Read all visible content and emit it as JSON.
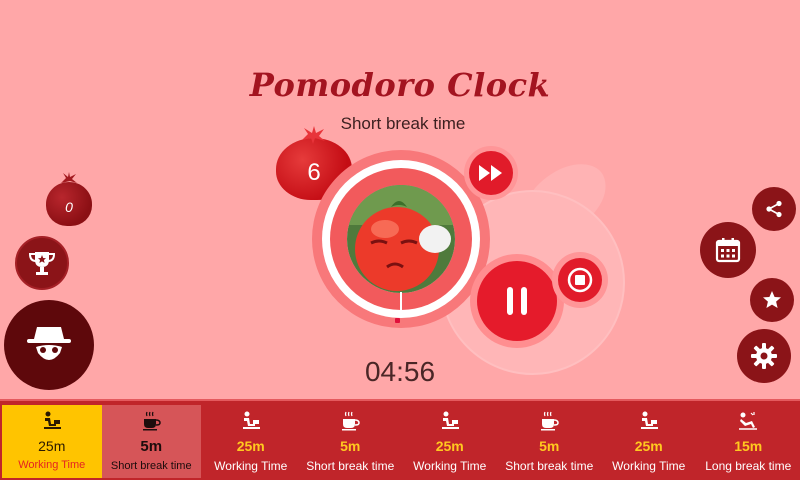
{
  "header": {
    "title": "Pomodoro Clock",
    "subtitle": "Short break time"
  },
  "timer": {
    "completed_tomatoes": "6",
    "remaining_time": "04:56"
  },
  "left_panel": {
    "daily_count": "0"
  },
  "controls": {
    "skip_icon": "fast-forward-icon",
    "pause_icon": "pause-icon",
    "stop_icon": "stop-icon"
  },
  "right_panel": {
    "icons": [
      "share-icon",
      "calendar-icon",
      "star-icon",
      "gear-icon"
    ]
  },
  "schedule": [
    {
      "icon": "worker-desk-icon",
      "duration": "25m",
      "label": "Working Time",
      "state": "active-work"
    },
    {
      "icon": "coffee-cup-icon",
      "duration": "5m",
      "label": "Short break time",
      "state": "active-break"
    },
    {
      "icon": "worker-desk-icon",
      "duration": "25m",
      "label": "Working Time",
      "state": "work"
    },
    {
      "icon": "coffee-cup-icon",
      "duration": "5m",
      "label": "Short break time",
      "state": "break"
    },
    {
      "icon": "worker-desk-icon",
      "duration": "25m",
      "label": "Working Time",
      "state": "work"
    },
    {
      "icon": "coffee-cup-icon",
      "duration": "5m",
      "label": "Short break time",
      "state": "break"
    },
    {
      "icon": "worker-desk-icon",
      "duration": "25m",
      "label": "Working Time",
      "state": "work"
    },
    {
      "icon": "lounge-chair-icon",
      "duration": "15m",
      "label": "Long break time",
      "state": "work"
    }
  ],
  "colors": {
    "background": "#ffa7a8",
    "accent_red": "#e11b2a",
    "dark_red": "#8b1418",
    "highlight_yellow": "#ffc400",
    "bottom_bar": "#c0252a"
  }
}
